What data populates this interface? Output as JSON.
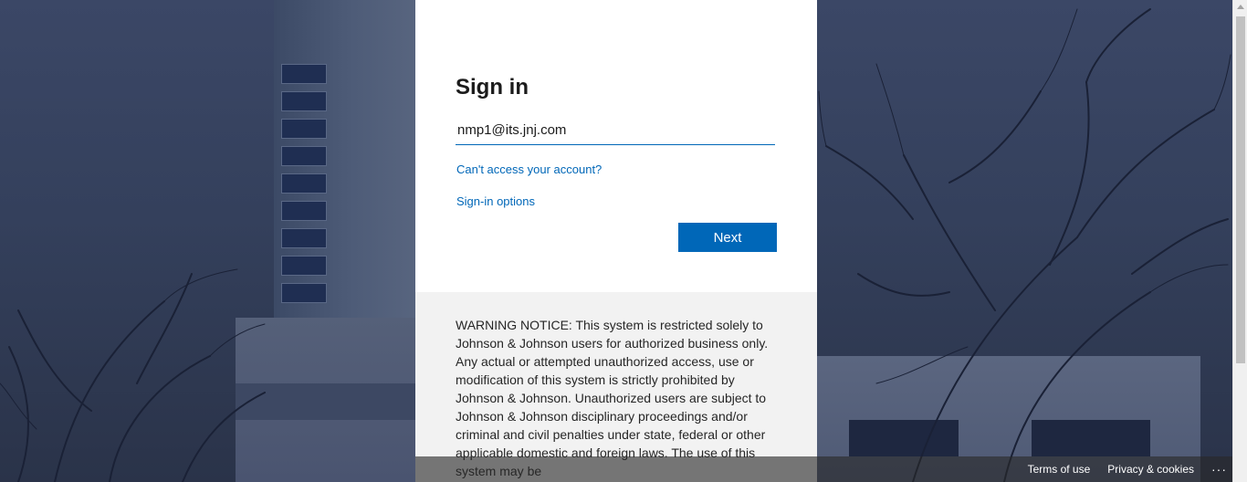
{
  "signin": {
    "title": "Sign in",
    "email_value": "nmp1@its.jnj.com",
    "cant_access_link": "Can't access your account?",
    "options_link": "Sign-in options",
    "next_label": "Next"
  },
  "notice": {
    "text": "WARNING NOTICE: This system is restricted solely to Johnson & Johnson users for authorized business only. Any actual or attempted unauthorized access, use or modification of this system is strictly prohibited by Johnson & Johnson. Unauthorized users are subject to Johnson & Johnson disciplinary proceedings and/or criminal and civil penalties under state, federal or other applicable domestic and foreign laws. The use of this system may be"
  },
  "footer": {
    "terms_label": "Terms of use",
    "privacy_label": "Privacy & cookies",
    "more_label": "···"
  },
  "colors": {
    "accent": "#0067b8",
    "card_bg": "#ffffff",
    "notice_bg": "#f2f2f2"
  }
}
